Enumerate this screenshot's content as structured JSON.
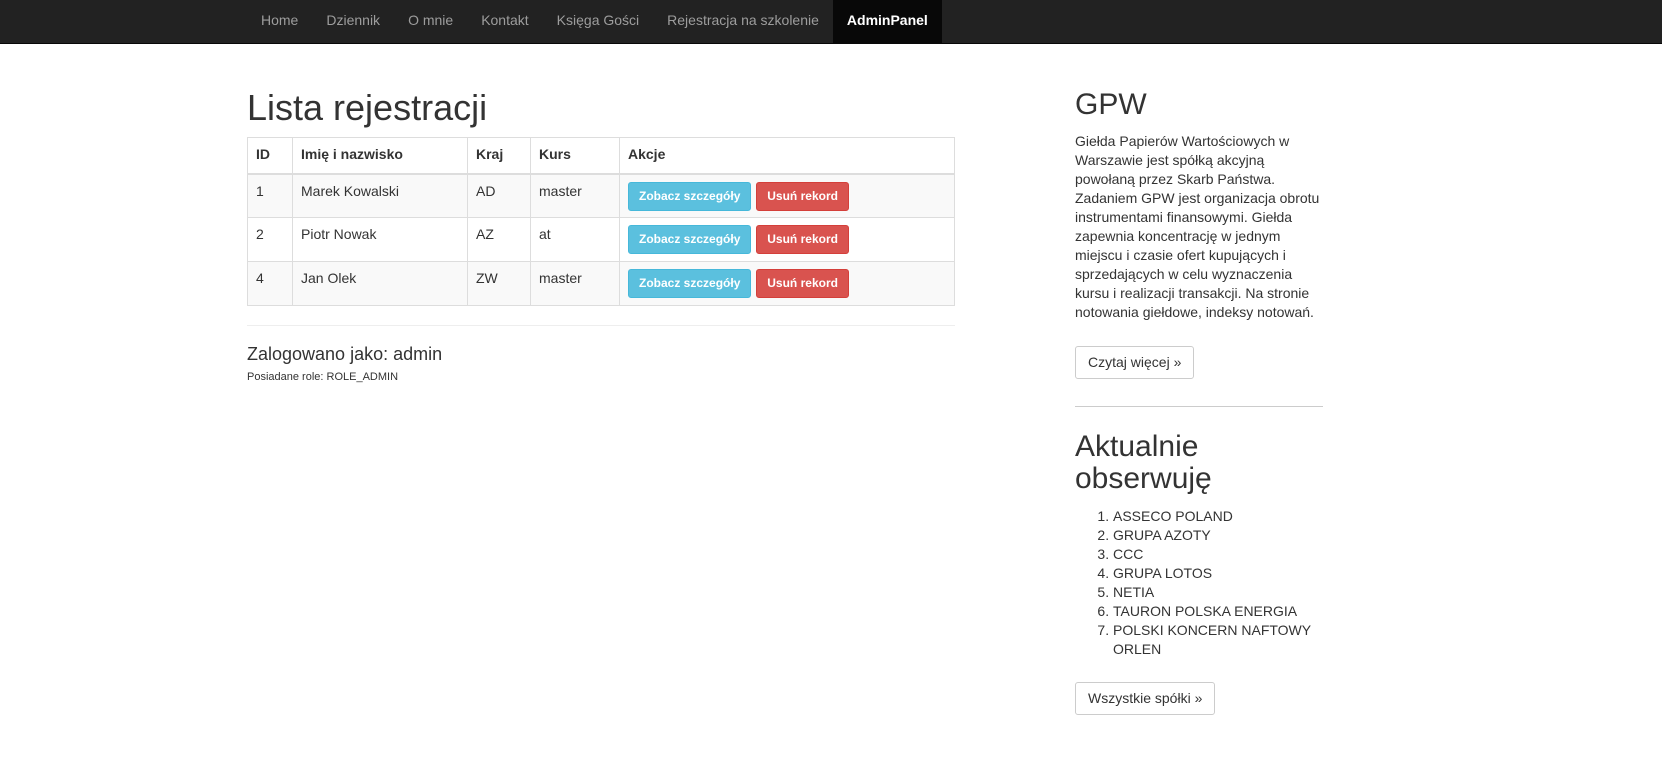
{
  "nav": {
    "items": [
      "Home",
      "Dziennik",
      "O mnie",
      "Kontakt",
      "Księga Gości",
      "Rejestracja na szkolenie",
      "AdminPanel"
    ],
    "active_index": 6
  },
  "main": {
    "title": "Lista rejestracji",
    "table": {
      "headers": [
        "ID",
        "Imię i nazwisko",
        "Kraj",
        "Kurs",
        "Akcje"
      ],
      "rows": [
        {
          "id": "1",
          "name": "Marek Kowalski",
          "country": "AD",
          "course": "master"
        },
        {
          "id": "2",
          "name": "Piotr Nowak",
          "country": "AZ",
          "course": "at"
        },
        {
          "id": "4",
          "name": "Jan Olek",
          "country": "ZW",
          "course": "master"
        }
      ],
      "details_label": "Zobacz szczegóły",
      "delete_label": "Usuń rekord"
    },
    "logged_as": "Zalogowano jako: admin",
    "roles": "Posiadane role: ROLE_ADMIN"
  },
  "sidebar": {
    "gpw_title": "GPW",
    "gpw_text": "Giełda Papierów Wartościowych w Warszawie jest spółką akcyjną powołaną przez Skarb Państwa. Zadaniem GPW jest organizacja obrotu instrumentami finansowymi. Giełda zapewnia koncentrację w jednym miejscu i czasie ofert kupujących i sprzedających w celu wyznaczenia kursu i realizacji transakcji. Na stronie notowania giełdowe, indeksy notowań.",
    "read_more": "Czytaj więcej »",
    "watch_title": "Aktualnie obserwuję",
    "watch_list": [
      "ASSECO POLAND",
      "GRUPA AZOTY",
      "CCC",
      "GRUPA LOTOS",
      "NETIA",
      "TAURON POLSKA ENERGIA",
      "POLSKI KONCERN NAFTOWY ORLEN"
    ],
    "all_companies": "Wszystkie spółki »"
  },
  "colors": {
    "navbar_bg": "#222222",
    "nav_active_bg": "#080808",
    "btn_info": "#5bc0de",
    "btn_danger": "#d9534f"
  }
}
